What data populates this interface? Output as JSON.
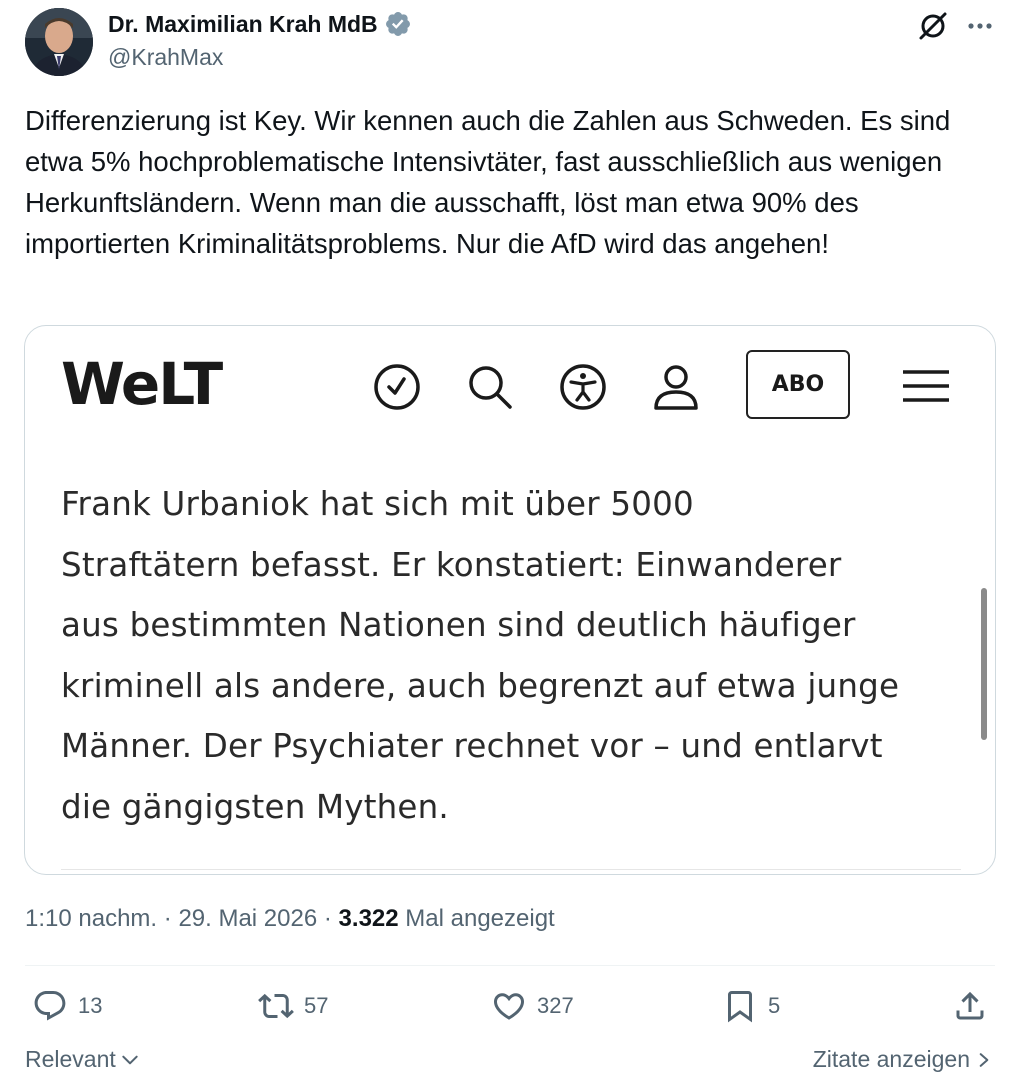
{
  "author": {
    "display_name": "Dr. Maximilian Krah MdB",
    "handle": "@KrahMax"
  },
  "tweet": {
    "text": "Differenzierung ist Key. Wir kennen auch die Zahlen aus Schweden. Es sind etwa 5% hochproblematische Intensivtäter, fast ausschließlich aus wenigen Herkunftsländern. Wenn man die ausschafft, löst man etwa 90% des importierten Kriminalitätsproblems. Nur die AfD wird das angehen!"
  },
  "media": {
    "logo": "WeLT",
    "abo_label": "ABO",
    "body_text": "Frank Urbaniok hat sich mit über 5000\nStraftätern befasst. Er konstatiert: Einwanderer\naus bestimmten Nationen sind deutlich häufiger\nkriminell als andere, auch begrenzt auf etwa junge\nMänner. Der Psychiater rechnet vor – und entlarvt\ndie gängigsten Mythen.",
    "icons": [
      "clock-icon",
      "search-icon",
      "accessibility-icon",
      "user-icon",
      "menu-icon"
    ]
  },
  "meta": {
    "time": "1:10 nachm.",
    "separator": "·",
    "date": "29. Mai 2026",
    "views_count": "3.322",
    "views_label": "Mal angezeigt"
  },
  "actions": {
    "replies": "13",
    "reposts": "57",
    "likes": "327",
    "bookmarks": "5"
  },
  "footer": {
    "sort_label": "Relevant",
    "quotes_label": "Zitate anzeigen"
  },
  "colors": {
    "verified": "#829aab",
    "text": "#0f1419",
    "secondary": "#536471"
  }
}
